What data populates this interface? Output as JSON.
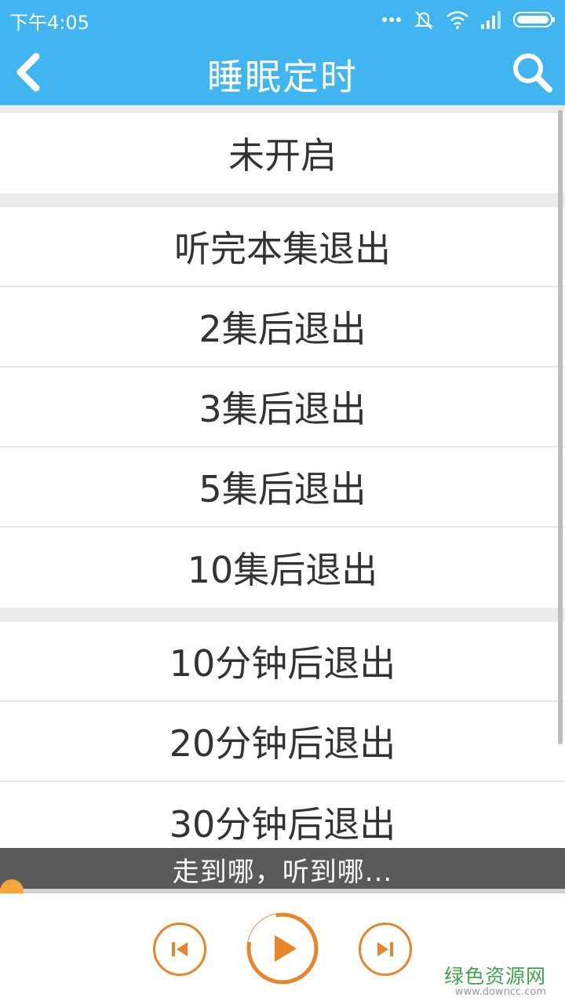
{
  "status_bar": {
    "time": "下午4:05",
    "icons": [
      "more-dots-icon",
      "mute-icon",
      "wifi-icon",
      "signal-icon",
      "battery-icon"
    ]
  },
  "header": {
    "title": "睡眠定时",
    "back_icon": "chevron-left-icon",
    "search_icon": "search-icon",
    "background": "#40b5ef"
  },
  "timer_options": {
    "group1": [
      "未开启"
    ],
    "group2": [
      "听完本集退出",
      "2集后退出",
      "3集后退出",
      "5集后退出",
      "10集后退出"
    ],
    "group3": [
      "10分钟后退出",
      "20分钟后退出",
      "30分钟后退出"
    ]
  },
  "marquee": {
    "text": "走到哪，听到哪..."
  },
  "player": {
    "progress": 0.0,
    "accent": "#e8852a",
    "controls": [
      "prev-icon",
      "play-icon",
      "next-icon"
    ]
  },
  "watermark": {
    "main": "绿色资源网",
    "sub": "www.downcc.com"
  }
}
